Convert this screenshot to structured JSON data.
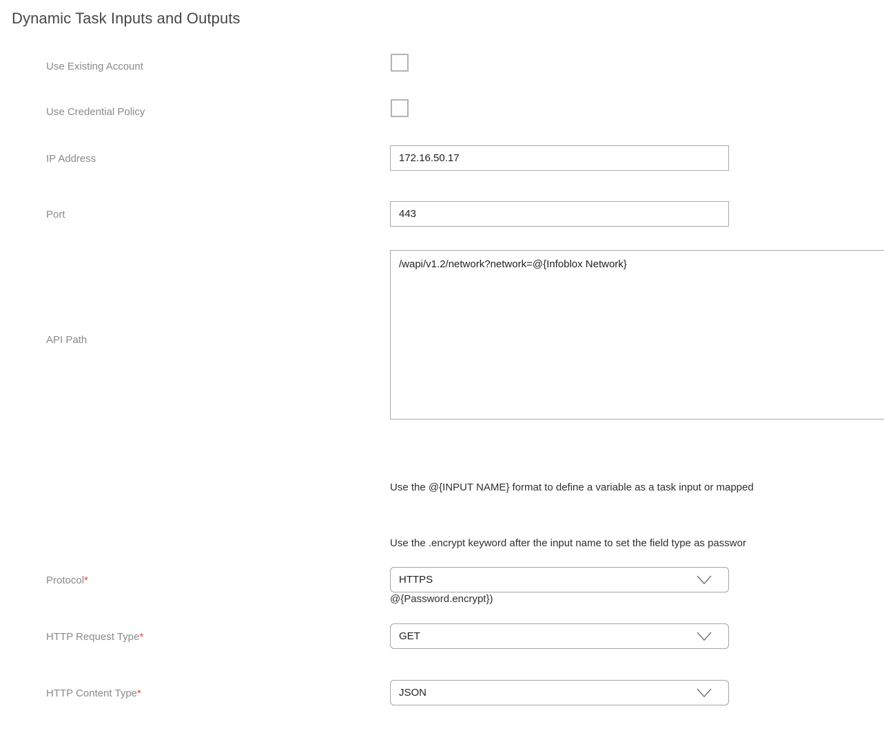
{
  "page": {
    "title": "Dynamic Task Inputs and Outputs"
  },
  "form": {
    "fields": [
      {
        "name": "use-existing-account",
        "label": "Use Existing Account",
        "type": "checkbox",
        "checked": false,
        "required": false
      },
      {
        "name": "use-credential-policy",
        "label": "Use Credential Policy",
        "type": "checkbox",
        "checked": false,
        "required": false
      },
      {
        "name": "ip-address",
        "label": "IP Address",
        "type": "text",
        "value": "172.16.50.17",
        "placeholder": "",
        "required": false
      },
      {
        "name": "port",
        "label": "Port",
        "type": "text",
        "value": "443",
        "placeholder": "",
        "required": false
      },
      {
        "name": "api-path",
        "label": "API Path",
        "type": "textarea",
        "value": "/wapi/v1.2/network?network=@{Infoblox Network}",
        "placeholder": "",
        "required": false
      },
      {
        "name": "protocol",
        "label": "Protocol",
        "type": "select",
        "value": "HTTPS",
        "required": true
      },
      {
        "name": "http-request-type",
        "label": "HTTP Request Type",
        "type": "select",
        "value": "GET",
        "required": true
      },
      {
        "name": "http-content-type",
        "label": "HTTP Content Type",
        "type": "select",
        "value": "JSON",
        "required": true
      }
    ],
    "required_marker": "*",
    "api_path_hint": {
      "line1": "Use the @{INPUT NAME} format to define a variable as a task input or mapped",
      "line2": "Use the .encrypt keyword after the input name to set the field type as passwor",
      "line3": "@{Password.encrypt})"
    }
  },
  "icons": {
    "chevron_down": "chevron-down-icon"
  },
  "colors": {
    "title_text": "#464646",
    "label_text": "#8a8a8a",
    "value_text": "#222222",
    "hint_text": "#2f2f2f",
    "required_asterisk": "#e8443a",
    "field_border": "#a9a9a9",
    "checkbox_border": "#b3b3b3",
    "background": "#ffffff"
  }
}
